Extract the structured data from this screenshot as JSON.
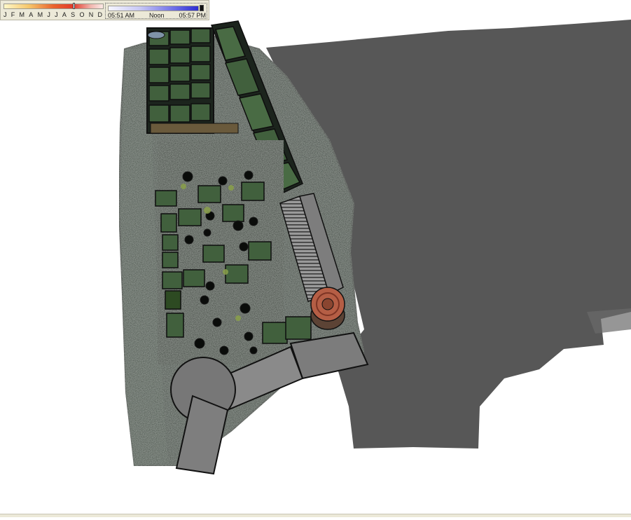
{
  "shadow_toolbar": {
    "months": [
      "J",
      "F",
      "M",
      "A",
      "M",
      "J",
      "J",
      "A",
      "S",
      "O",
      "N",
      "D"
    ],
    "month_slider_value": 0.72,
    "sunrise_label": "05:51 AM",
    "noon_label": "Noon",
    "sunset_label": "05:57 PM",
    "time_slider_value": 0.96
  },
  "scene": {
    "shadow_color": "#575757",
    "ground_color": "#2e3830",
    "roof_color": "#3f5a3a",
    "outline_color": "#111111"
  }
}
